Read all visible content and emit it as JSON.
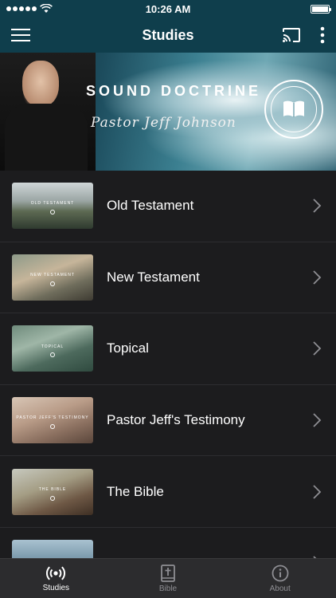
{
  "status_bar": {
    "time": "10:26 AM"
  },
  "nav": {
    "title": "Studies"
  },
  "banner": {
    "title": "SOUND DOCTRINE",
    "subtitle": "Pastor Jeff Johnson"
  },
  "studies": [
    {
      "label": "Old Testament",
      "thumb_label": "OLD TESTAMENT"
    },
    {
      "label": "New Testament",
      "thumb_label": "NEW TESTAMENT"
    },
    {
      "label": "Topical",
      "thumb_label": "TOPICAL"
    },
    {
      "label": "Pastor Jeff's Testimony",
      "thumb_label": "PASTOR JEFF'S TESTIMONY"
    },
    {
      "label": "The Bible",
      "thumb_label": "THE BIBLE"
    },
    {
      "label": "",
      "thumb_label": ""
    }
  ],
  "tabs": [
    {
      "label": "Studies",
      "icon": "broadcast-icon",
      "active": true
    },
    {
      "label": "Bible",
      "icon": "bible-icon",
      "active": false
    },
    {
      "label": "About",
      "icon": "info-icon",
      "active": false
    }
  ],
  "colors": {
    "header": "#0f3e4c",
    "background": "#1c1c1e",
    "tab_bar": "#2c2c2e"
  }
}
